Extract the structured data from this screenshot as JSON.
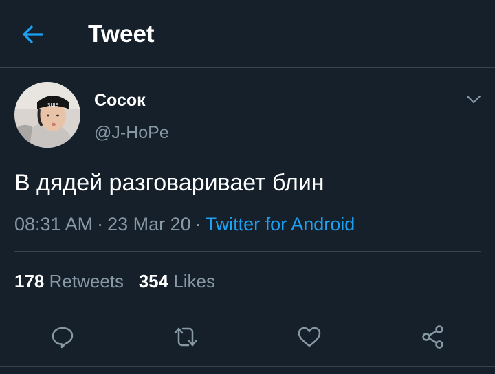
{
  "header": {
    "title": "Tweet",
    "back_icon": "arrow-left-icon"
  },
  "tweet": {
    "author": {
      "display_name": "Сосок",
      "handle": "@J-HoPe"
    },
    "text": "В дядей разговаривает блин",
    "time": "08:31 AM",
    "date": "23 Mar 20",
    "separator": "·",
    "source": "Twitter for Android",
    "stats": {
      "retweets_count": "178",
      "retweets_label": "Retweets",
      "likes_count": "354",
      "likes_label": "Likes"
    }
  },
  "actions": [
    "reply-icon",
    "retweet-icon",
    "like-icon",
    "share-icon"
  ],
  "colors": {
    "background": "#15202b",
    "accent": "#1da1f2",
    "secondary_text": "#8899a6",
    "divider": "#38444d"
  }
}
